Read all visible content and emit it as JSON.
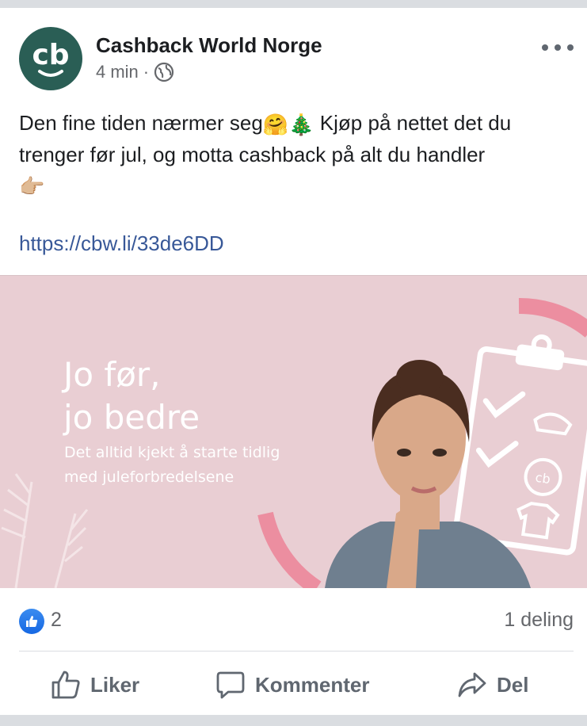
{
  "post": {
    "page_name": "Cashback World Norge",
    "time": "4 min",
    "separator": "·",
    "avatar_text": "cb",
    "text_line1": "Den fine tiden nærmer seg",
    "emoji_hug": "🤗",
    "emoji_tree": "🎄",
    "text_line1b": " Kjøp på nettet det du trenger før jul, og motta cashback på alt du handler",
    "emoji_point": "👉🏼",
    "link": "https://cbw.li/33de6DD"
  },
  "image": {
    "title_line1": "Jo før,",
    "title_line2": "jo bedre",
    "subtitle_line1": "Det alltid kjekt å starte tidlig",
    "subtitle_line2": "med juleforbredelsene",
    "badge_text": "cb",
    "background": "#e9ced3"
  },
  "stats": {
    "likes": "2",
    "shares": "1 deling"
  },
  "actions": {
    "like": "Liker",
    "comment": "Kommenter",
    "share": "Del"
  },
  "colors": {
    "brand": "#2a5e55",
    "link": "#385898",
    "like_blue": "#1877f2",
    "accent_pink": "#ec8ea0"
  },
  "icons": {
    "globe": "globe-icon",
    "more": "more-dots-icon",
    "like": "thumbs-up-icon",
    "comment": "comment-icon",
    "share": "share-arrow-icon"
  }
}
